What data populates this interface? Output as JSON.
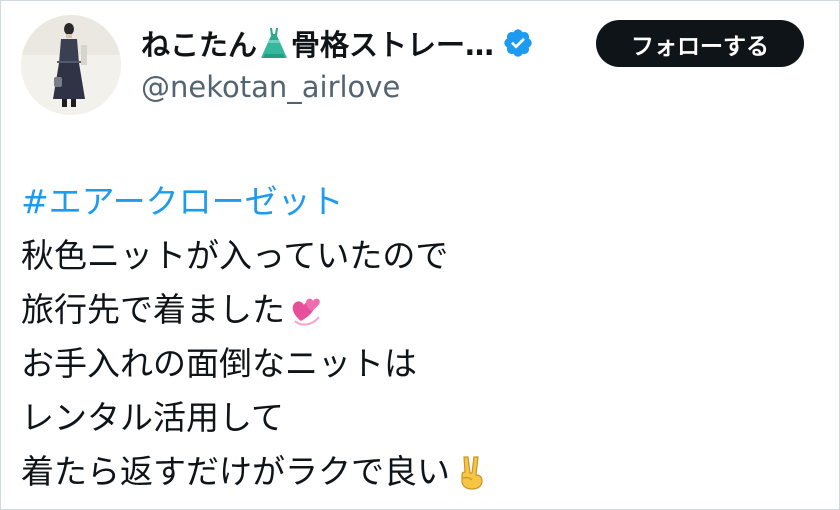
{
  "user": {
    "display_name": "ねこたん",
    "display_name_suffix": "骨格ストレー…",
    "dress_emoji": "dress-icon",
    "verified_icon": "verified-badge-icon",
    "handle": "@nekotan_airlove"
  },
  "follow_button": {
    "label": "フォローする"
  },
  "tweet": {
    "hashtag": "#エアークローゼット",
    "lines": [
      "秋色ニットが入っていたので",
      "旅行先で着ました",
      "お手入れの面倒なニットは",
      "レンタル活用して",
      "着たら返すだけがラクで良い"
    ],
    "emojis": {
      "line2": "revolving-hearts-icon",
      "line6": "victory-hand-icon"
    }
  },
  "colors": {
    "link": "#1d9bf0",
    "text": "#0f1419",
    "secondary": "#536471",
    "button_bg": "#0f1419",
    "verified": "#1d9bf0"
  }
}
